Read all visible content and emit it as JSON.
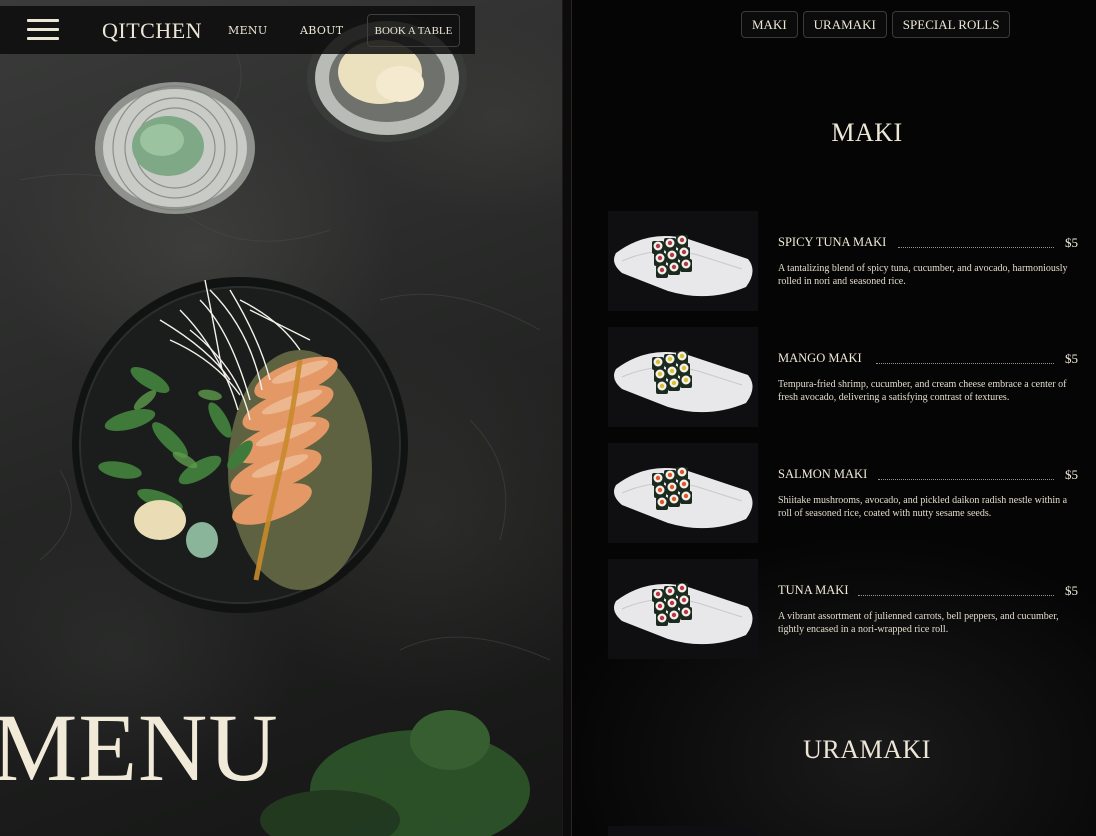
{
  "nav": {
    "brand": "QITCHEN",
    "links": [
      "MENU",
      "ABOUT"
    ],
    "cta": "BOOK A TABLE"
  },
  "hero": {
    "title": "MENU"
  },
  "categories": [
    "MAKI",
    "URAMAKI",
    "SPECIAL ROLLS"
  ],
  "sections": [
    {
      "title": "MAKI",
      "items": [
        {
          "name": "SPICY TUNA MAKI",
          "price": "$5",
          "description": "A tantalizing blend of spicy tuna, cucumber, and avocado, harmoniously rolled in nori and seasoned rice.",
          "fill": "#b23a4a"
        },
        {
          "name": "MANGO MAKI",
          "price": "$5",
          "description": "Tempura-fried shrimp, cucumber, and cream cheese embrace a center of fresh avocado, delivering a satisfying contrast of textures.",
          "fill": "#d8c235"
        },
        {
          "name": "SALMON MAKI",
          "price": "$5",
          "description": "Shiitake mushrooms, avocado, and pickled daikon radish nestle within a roll of seasoned rice, coated with nutty sesame seeds.",
          "fill": "#e0572a"
        },
        {
          "name": "TUNA MAKI",
          "price": "$5",
          "description": "A vibrant assortment of julienned carrots, bell peppers, and cucumber, tightly encased in a nori-wrapped rice roll.",
          "fill": "#c23246"
        }
      ]
    },
    {
      "title": "URAMAKI",
      "items": []
    }
  ],
  "colors": {
    "accent": "#efe7d2",
    "panel": "#050505"
  },
  "icons": [
    "hamburger-menu-icon"
  ]
}
